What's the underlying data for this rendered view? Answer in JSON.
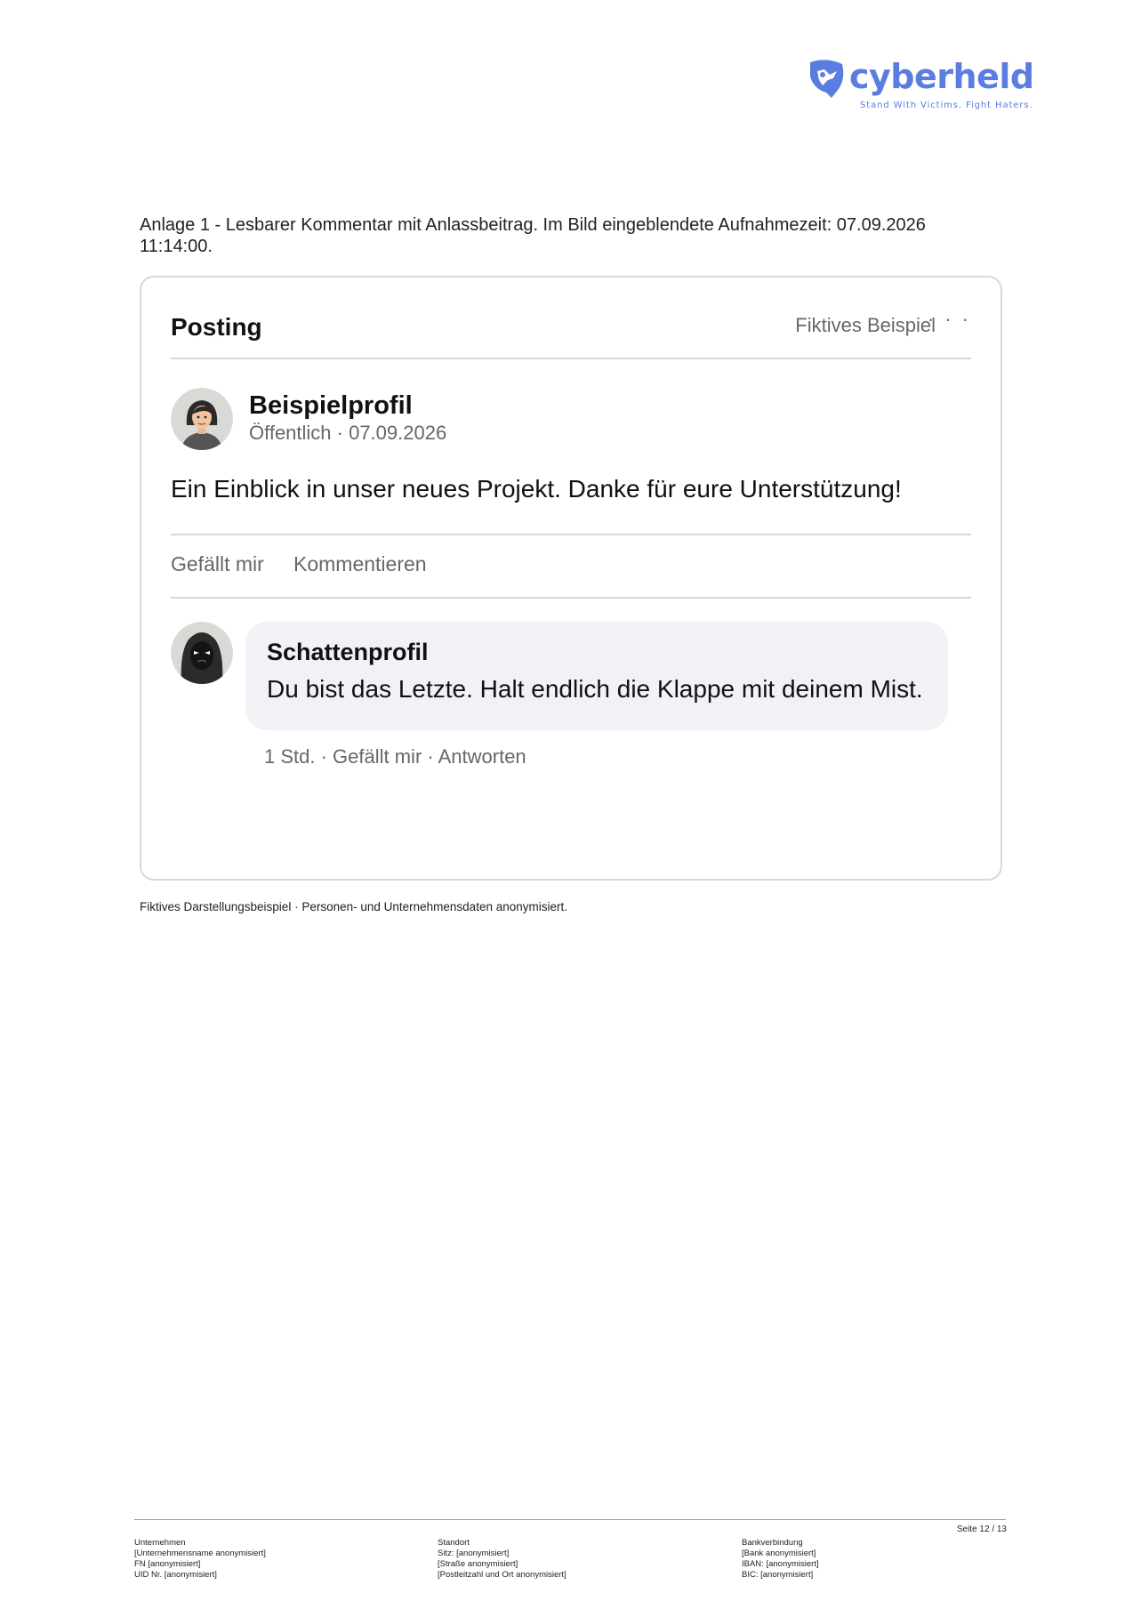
{
  "logo": {
    "wordmark": "cyberheld",
    "tagline": "Stand With Victims. Fight Haters.",
    "brand_color": "#5b7ce0"
  },
  "caption": "Anlage 1 - Lesbarer Kommentar mit Anlassbeitrag. Im Bild eingeblendete Aufnahmezeit: 07.09.2026 11:14:00.",
  "card": {
    "title": "Posting",
    "label": "Fiktives Beispiel",
    "more_icon": "more-horizontal-icon",
    "post": {
      "author": "Beispielprofil",
      "meta": "Öffentlich · 07.09.2026",
      "text": "Ein Einblick in unser neues Projekt. Danke für eure Unterstützung!",
      "actions": {
        "like": "Gefällt mir",
        "comment": "Kommentieren"
      }
    },
    "comment": {
      "author": "Schattenprofil",
      "text": "Du bist das Letzte. Halt endlich die Klappe mit deinem Mist.",
      "meta": "1 Std. · Gefällt mir · Antworten"
    }
  },
  "disclaimer": "Fiktives Darstellungsbeispiel · Personen- und Unternehmensdaten anonymisiert.",
  "footer": {
    "page": "Seite 12 / 13",
    "company": {
      "heading": "Unternehmen",
      "lines": [
        "[Unternehmensname anonymisiert]",
        "FN [anonymisiert]",
        "UID Nr. [anonymisiert]"
      ]
    },
    "location": {
      "heading": "Standort",
      "lines": [
        "Sitz: [anonymisiert]",
        "[Straße anonymisiert]",
        "[Postleitzahl und Ort anonymisiert]"
      ]
    },
    "bank": {
      "heading": "Bankverbindung",
      "lines": [
        "[Bank anonymisiert]",
        "IBAN: [anonymisiert]",
        "BIC: [anonymisiert]"
      ]
    }
  }
}
